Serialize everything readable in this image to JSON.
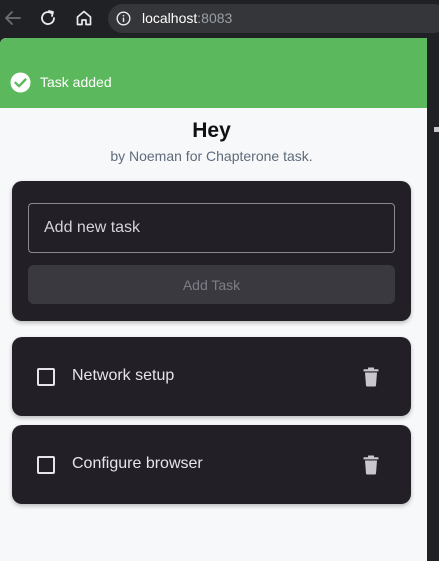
{
  "browser": {
    "url_host": "localhost",
    "url_port": ":8083"
  },
  "toast": {
    "message": "Task added",
    "color": "#5cb85c"
  },
  "header": {
    "title": "Hey",
    "subtitle": "by Noeman for Chapterone task."
  },
  "form": {
    "input_placeholder": "Add new task",
    "input_value": "",
    "add_button_label": "Add Task"
  },
  "tasks": [
    {
      "label": "Network setup",
      "done": false
    },
    {
      "label": "Configure browser",
      "done": false
    }
  ],
  "icons": {
    "back": "arrow-left-icon",
    "reload": "reload-icon",
    "home": "home-icon",
    "info": "info-icon",
    "toast": "check-circle-icon",
    "delete": "trash-icon"
  }
}
